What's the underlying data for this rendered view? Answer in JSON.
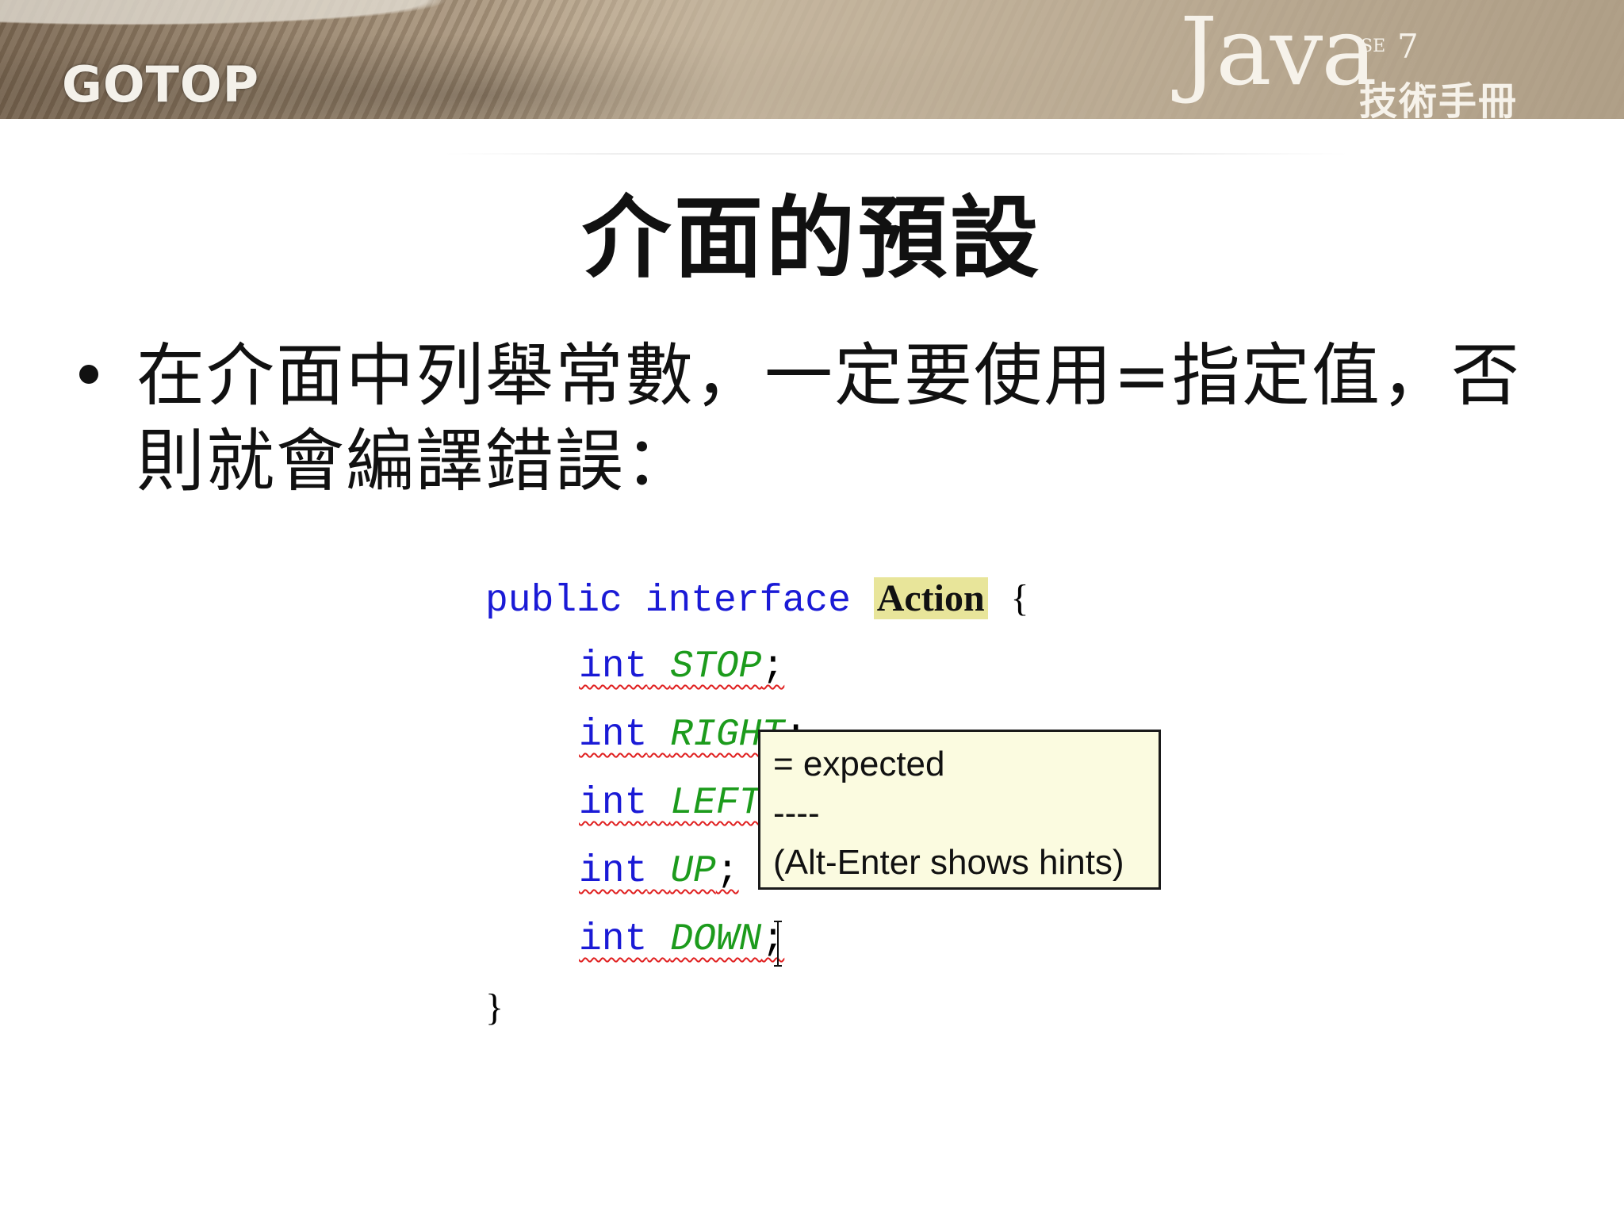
{
  "header": {
    "publisher_logo": "GOTOP",
    "book_logo": {
      "word": "Java",
      "edition_prefix": "SE",
      "edition_number": "7",
      "subtitle": "技術手冊"
    }
  },
  "slide": {
    "title": "介面的預設",
    "bullets": [
      "在介面中列舉常數，一定要使用=指定值，否則就會編譯錯誤："
    ]
  },
  "code": {
    "line1": {
      "kw_public": "public",
      "kw_interface": "interface",
      "name": "Action",
      "open_brace": "{"
    },
    "fields": [
      {
        "type": "int",
        "name": "STOP",
        "end": ";"
      },
      {
        "type": "int",
        "name": "RIGHT",
        "end": ";"
      },
      {
        "type": "int",
        "name": "LEFT",
        "end": ";"
      },
      {
        "type": "int",
        "name": "UP",
        "end": ";"
      },
      {
        "type": "int",
        "name": "DOWN",
        "end": ";"
      }
    ],
    "close_brace": "}"
  },
  "tooltip": {
    "line1": "= expected",
    "line2": "----",
    "line3": "(Alt-Enter shows hints)"
  }
}
